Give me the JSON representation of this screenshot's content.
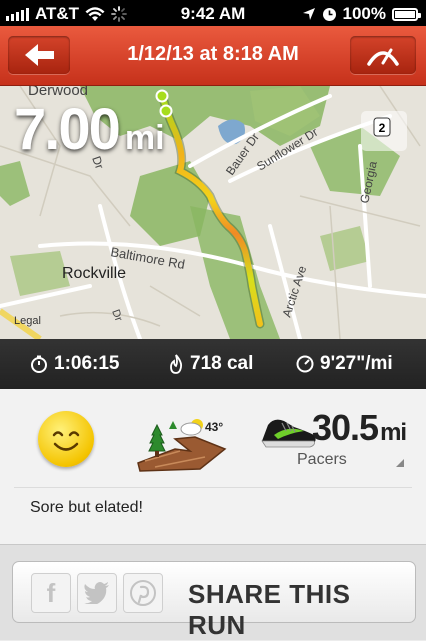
{
  "status_bar": {
    "carrier": "AT&T",
    "time": "9:42 AM",
    "battery": "100%",
    "icons": [
      "signal-bars-icon",
      "wifi-icon",
      "activity-spinner-icon",
      "location-arrow-icon",
      "alarm-clock-icon",
      "battery-icon"
    ]
  },
  "nav": {
    "title": "1/12/13 at 8:18 AM",
    "icons": [
      "back-arrow-icon",
      "speedometer-icon"
    ]
  },
  "map": {
    "distance_value": "7.00",
    "distance_unit": "mi",
    "marker_label": "2",
    "legal_label": "Legal",
    "labels": {
      "derwood": "Derwood",
      "rockville": "Rockville",
      "baltimore_rd": "Baltimore Rd",
      "bauer_dr": "Bauer Dr",
      "sunflower_dr": "Sunflower Dr",
      "georgia": "Georgia",
      "arctic_ave": "Arctic Ave",
      "e_dr": "Dr",
      "cut_word": "Dr"
    }
  },
  "stats": {
    "duration": "1:06:15",
    "calories": "718 cal",
    "pace": "9'27\"/mi",
    "icons": [
      "stopwatch-icon",
      "flame-icon",
      "pace-gauge-icon"
    ]
  },
  "summary": {
    "mood_icon": "smiley-face-icon",
    "terrain_icon": "trail-terrain-icon",
    "weather_icon": "partly-cloudy-icon",
    "temperature": "43°",
    "shoe_icon": "running-shoe-icon",
    "shoe_distance": "30.5",
    "shoe_unit": "mi",
    "shoe_name": "Pacers",
    "note": "Sore but elated!"
  },
  "share": {
    "label": "SHARE THIS RUN",
    "icons": [
      "facebook-icon",
      "twitter-icon",
      "pinterest-icon"
    ]
  },
  "colors": {
    "nav_red": "#d9432a",
    "route_green": "#a6dd1c",
    "route_yellow": "#f2d21a",
    "route_orange": "#f08a25",
    "park_green": "#8ab661",
    "water_blue": "#7ea8cf",
    "stats_bg": "#2a2a2a"
  }
}
